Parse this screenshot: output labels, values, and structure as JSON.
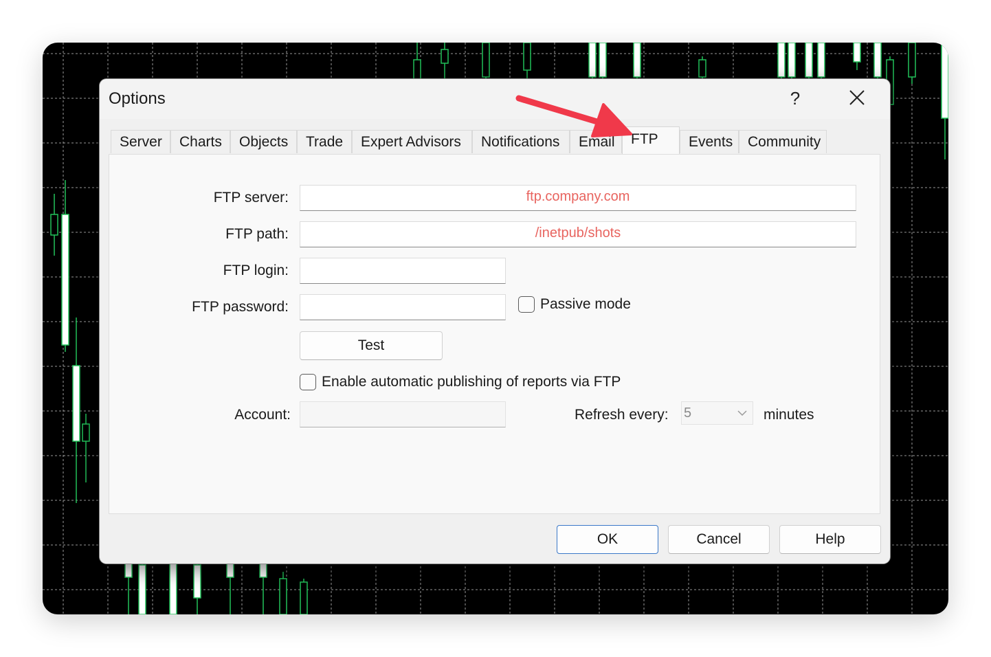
{
  "dialog": {
    "title": "Options",
    "help_glyph": "?"
  },
  "tabs": [
    {
      "label": "Server",
      "active": false
    },
    {
      "label": "Charts",
      "active": false
    },
    {
      "label": "Objects",
      "active": false
    },
    {
      "label": "Trade",
      "active": false
    },
    {
      "label": "Expert Advisors",
      "active": false
    },
    {
      "label": "Notifications",
      "active": false
    },
    {
      "label": "Email",
      "active": false
    },
    {
      "label": "FTP",
      "active": true
    },
    {
      "label": "Events",
      "active": false
    },
    {
      "label": "Community",
      "active": false
    }
  ],
  "ftp": {
    "server_label": "FTP server:",
    "server_value": "ftp.company.com",
    "path_label": "FTP path:",
    "path_value": "/inetpub/shots",
    "login_label": "FTP login:",
    "login_value": "",
    "password_label": "FTP password:",
    "password_value": "",
    "passive_label": "Passive mode",
    "passive_checked": false,
    "test_label": "Test",
    "enable_label": "Enable automatic publishing of reports via FTP",
    "enable_checked": false,
    "account_label": "Account:",
    "account_value": "",
    "refresh_label": "Refresh every:",
    "refresh_value": "5",
    "minutes_label": "minutes"
  },
  "footer": {
    "ok_label": "OK",
    "cancel_label": "Cancel",
    "help_label": "Help"
  },
  "colors": {
    "accent_arrow": "#f0394a",
    "field_text": "#e8645f",
    "chart_candle": "#22c25a",
    "primary_border": "#3a78c8"
  },
  "icons": {
    "close": "close-icon",
    "help": "help-icon",
    "dropdown": "chevron-down-icon",
    "annotation": "arrow-annotation-icon"
  }
}
